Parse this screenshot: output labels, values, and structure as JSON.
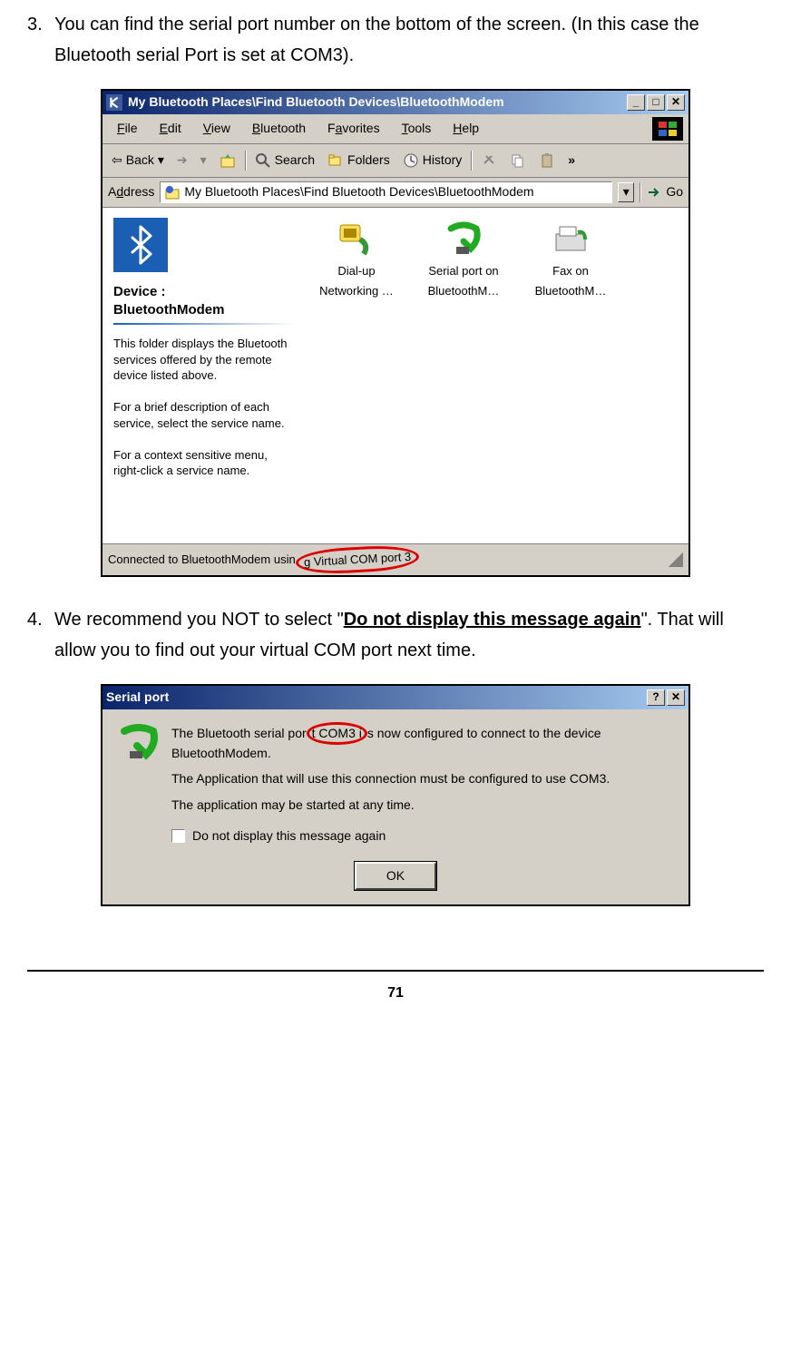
{
  "step3": {
    "num": "3.",
    "text_a": "You can find the serial port number on the bottom of the screen. (In this case the Bluetooth serial Port is set at COM3)."
  },
  "step4": {
    "num": "4.",
    "text_a": "We recommend you NOT to select \"",
    "bold": "Do not display this message again",
    "text_b": "\". That will allow you to find out your virtual COM port next time."
  },
  "win1": {
    "title": "My Bluetooth Places\\Find Bluetooth Devices\\BluetoothModem",
    "menus": {
      "file": "File",
      "edit": "Edit",
      "view": "View",
      "bluetooth": "Bluetooth",
      "favorites": "Favorites",
      "tools": "Tools",
      "help": "Help"
    },
    "toolbar": {
      "back": "Back",
      "search": "Search",
      "folders": "Folders",
      "history": "History",
      "chev": "»"
    },
    "addr": {
      "label": "Address",
      "value": "My Bluetooth Places\\Find Bluetooth Devices\\BluetoothModem",
      "go": "Go"
    },
    "left": {
      "device_lbl": "Device :",
      "device_name": "BluetoothModem",
      "p1": "This folder displays the Bluetooth services offered by the remote device listed above.",
      "p2": "For a brief description of each service, select the service name.",
      "p3": "For a context sensitive menu, right-click a service name."
    },
    "services": {
      "s1": "Dial-up Networking …",
      "s2": "Serial port on BluetoothM…",
      "s3": "Fax on BluetoothM…"
    },
    "status_a": "Connected to BluetoothModem usin",
    "status_b": "g Virtual COM port 3"
  },
  "dialog": {
    "title": "Serial port",
    "line1a": "The Bluetooth serial por",
    "line1_hl": "t COM3 i",
    "line1b": "s now configured to connect to the device BluetoothModem.",
    "line2": "The Application that will use this connection must be configured to use COM3.",
    "line3": "The application may be started at any time.",
    "checkbox": "Do not display this message again",
    "ok": "OK"
  },
  "page": "71"
}
